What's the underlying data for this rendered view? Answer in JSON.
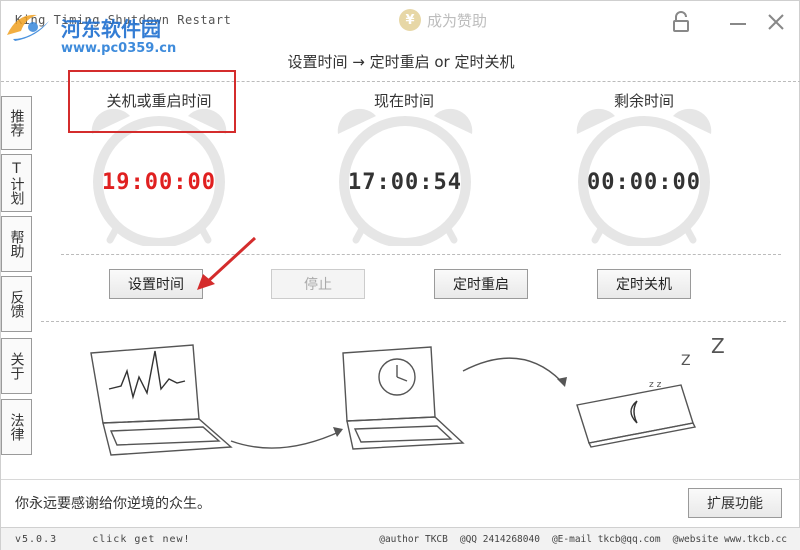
{
  "window": {
    "title": "King Timing Shutdown Restart",
    "donate_label": "成为赞助",
    "donate_coin": "¥"
  },
  "watermark": {
    "name": "河东软件园",
    "url": "www.pc0359.cn"
  },
  "subtitle": "设置时间 → 定时重启 or 定时关机",
  "sidebar": {
    "items": [
      {
        "label": "推荐"
      },
      {
        "label": "T计划"
      },
      {
        "label": "帮助"
      },
      {
        "label": "反馈"
      },
      {
        "label": "关于"
      },
      {
        "label": "法律"
      }
    ]
  },
  "clocks": [
    {
      "label": "关机或重启时间",
      "time": "19:00:00",
      "color": "#e02020"
    },
    {
      "label": "现在时间",
      "time": "17:00:54",
      "color": "#333333"
    },
    {
      "label": "剩余时间",
      "time": "00:00:00",
      "color": "#333333"
    }
  ],
  "buttons": {
    "set_time": "设置时间",
    "stop": "停止",
    "restart": "定时重启",
    "shutdown": "定时关机",
    "expand": "扩展功能"
  },
  "quote": "你永远要感谢给你逆境的众生。",
  "status": {
    "version": "v5.0.3",
    "slogan": "click get new!",
    "author": "@author TKCB",
    "qq": "@QQ 2414268040",
    "email": "@E-mail tkcb@qq.com",
    "website": "@website www.tkcb.cc"
  },
  "colors": {
    "highlight": "#d42c2c",
    "watermark": "#1f6fd0"
  }
}
